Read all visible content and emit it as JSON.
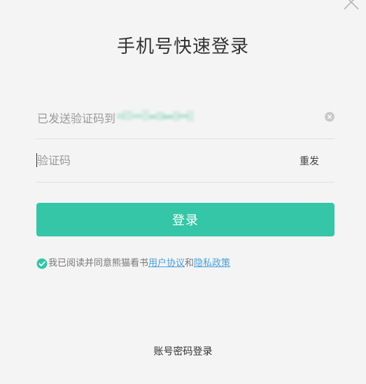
{
  "dialog": {
    "title": "手机号快速登录"
  },
  "phone_row": {
    "sent_text": "已发送验证码到"
  },
  "code_row": {
    "placeholder": "验证码",
    "value": "",
    "resend_label": "重发"
  },
  "login_button": {
    "label": "登录"
  },
  "agreement": {
    "prefix": "我已阅读并同意熊猫看书",
    "user_agreement": "用户协议",
    "and": "和",
    "privacy_policy": "隐私政策",
    "checked": true
  },
  "footer": {
    "password_login": "账号密码登录"
  },
  "colors": {
    "accent": "#34c6a6",
    "link": "#4a9fdb",
    "background": "#f4f4f4"
  },
  "icons": {
    "close": "close-icon",
    "clear": "clear-icon",
    "check": "check-circle-icon"
  }
}
